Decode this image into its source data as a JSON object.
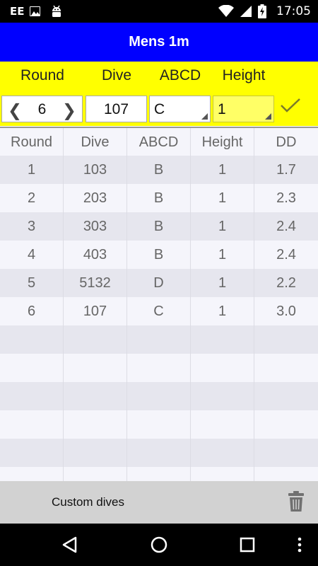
{
  "status_bar": {
    "carrier": "EE",
    "time": "17:05",
    "icons": [
      "image-icon",
      "android-icon",
      "wifi-icon",
      "signal-icon",
      "battery-charging-icon"
    ]
  },
  "title": "Mens 1m",
  "entry": {
    "headers": [
      "Round",
      "Dive",
      "ABCD",
      "Height"
    ],
    "round_value": "6",
    "dive_value": "107",
    "abcd_value": "C",
    "height_value": "1"
  },
  "table": {
    "columns": [
      "Round",
      "Dive",
      "ABCD",
      "Height",
      "DD"
    ],
    "rows": [
      [
        "1",
        "103",
        "B",
        "1",
        "1.7"
      ],
      [
        "2",
        "203",
        "B",
        "1",
        "2.3"
      ],
      [
        "3",
        "303",
        "B",
        "1",
        "2.4"
      ],
      [
        "4",
        "403",
        "B",
        "1",
        "2.4"
      ],
      [
        "5",
        "5132",
        "D",
        "1",
        "2.2"
      ],
      [
        "6",
        "107",
        "C",
        "1",
        "3.0"
      ]
    ]
  },
  "bottom_bar": {
    "label": "Custom dives"
  },
  "colors": {
    "title_bg": "#0000ff",
    "entry_bg": "#ffff00",
    "height_field_bg": "#ffff66"
  }
}
